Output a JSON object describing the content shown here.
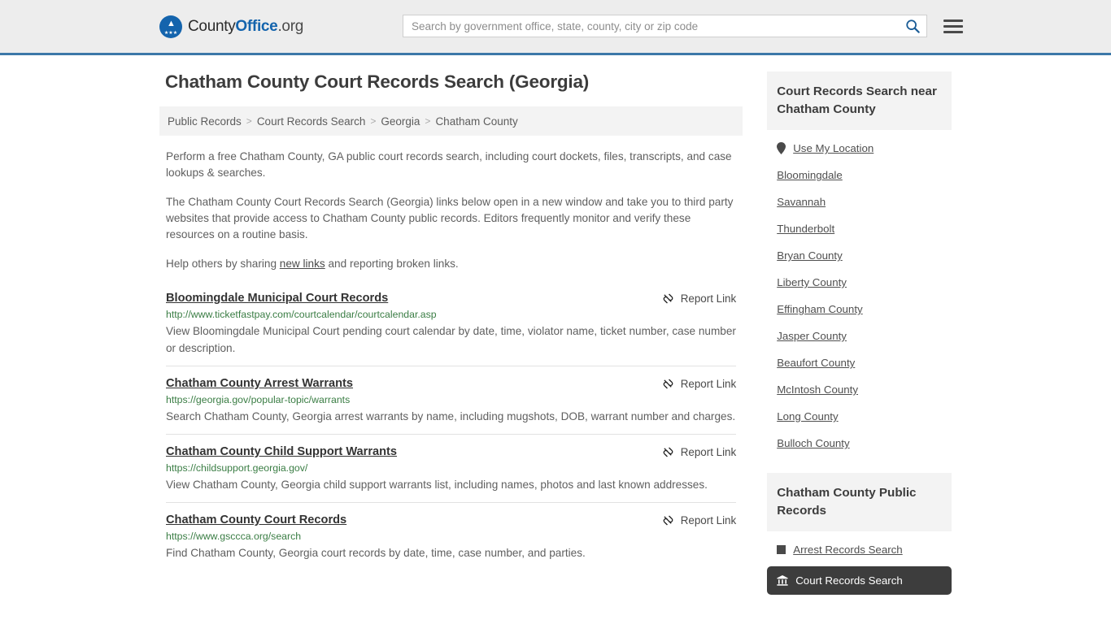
{
  "header": {
    "logo": {
      "part1": "County",
      "part2": "Office",
      "part3": ".org",
      "icon": "eagle-shield-logo"
    },
    "search": {
      "placeholder": "Search by government office, state, county, city or zip code",
      "value": ""
    },
    "search_icon": "search-icon",
    "menu_icon": "hamburger-menu-icon"
  },
  "main": {
    "title": "Chatham County Court Records Search (Georgia)",
    "breadcrumb": [
      {
        "label": "Public Records"
      },
      {
        "label": "Court Records Search"
      },
      {
        "label": "Georgia"
      },
      {
        "label": "Chatham County"
      }
    ],
    "breadcrumb_separator": ">",
    "intro": {
      "p1": "Perform a free Chatham County, GA public court records search, including court dockets, files, transcripts, and case lookups & searches.",
      "p2": "The Chatham County Court Records Search (Georgia) links below open in a new window and take you to third party websites that provide access to Chatham County public records. Editors frequently monitor and verify these resources on a routine basis.",
      "p3_before": "Help others by sharing ",
      "p3_link": "new links",
      "p3_after": " and reporting broken links."
    },
    "report_link_label": "Report Link",
    "report_link_icon": "broken-link-icon",
    "results": [
      {
        "title": "Bloomingdale Municipal Court Records",
        "url": "http://www.ticketfastpay.com/courtcalendar/courtcalendar.asp",
        "description": "View Bloomingdale Municipal Court pending court calendar by date, time, violator name, ticket number, case number or description."
      },
      {
        "title": "Chatham County Arrest Warrants",
        "url": "https://georgia.gov/popular-topic/warrants",
        "description": "Search Chatham County, Georgia arrest warrants by name, including mugshots, DOB, warrant number and charges."
      },
      {
        "title": "Chatham County Child Support Warrants",
        "url": "https://childsupport.georgia.gov/",
        "description": "View Chatham County, Georgia child support warrants list, including names, photos and last known addresses."
      },
      {
        "title": "Chatham County Court Records",
        "url": "https://www.gsccca.org/search",
        "description": "Find Chatham County, Georgia court records by date, time, case number, and parties."
      }
    ]
  },
  "sidebar": {
    "nearby_heading": "Court Records Search near Chatham County",
    "use_my_location": {
      "label": "Use My Location",
      "icon": "map-pin-icon"
    },
    "nearby_items": [
      {
        "label": "Bloomingdale"
      },
      {
        "label": "Savannah"
      },
      {
        "label": "Thunderbolt"
      },
      {
        "label": "Bryan County"
      },
      {
        "label": "Liberty County"
      },
      {
        "label": "Effingham County"
      },
      {
        "label": "Jasper County"
      },
      {
        "label": "Beaufort County"
      },
      {
        "label": "McIntosh County"
      },
      {
        "label": "Long County"
      },
      {
        "label": "Bulloch County"
      }
    ],
    "public_records_heading": "Chatham County Public Records",
    "public_records_items": [
      {
        "label": "Arrest Records Search",
        "icon": "square-icon",
        "active": false
      },
      {
        "label": "Court Records Search",
        "icon": "bank-icon",
        "active": true
      }
    ]
  },
  "colors": {
    "brand_blue": "#1464ad",
    "header_border": "#3c78a8",
    "url_green": "#3a7d44",
    "panel_gray": "#f3f3f3",
    "active_dark": "#3d3d3d"
  }
}
